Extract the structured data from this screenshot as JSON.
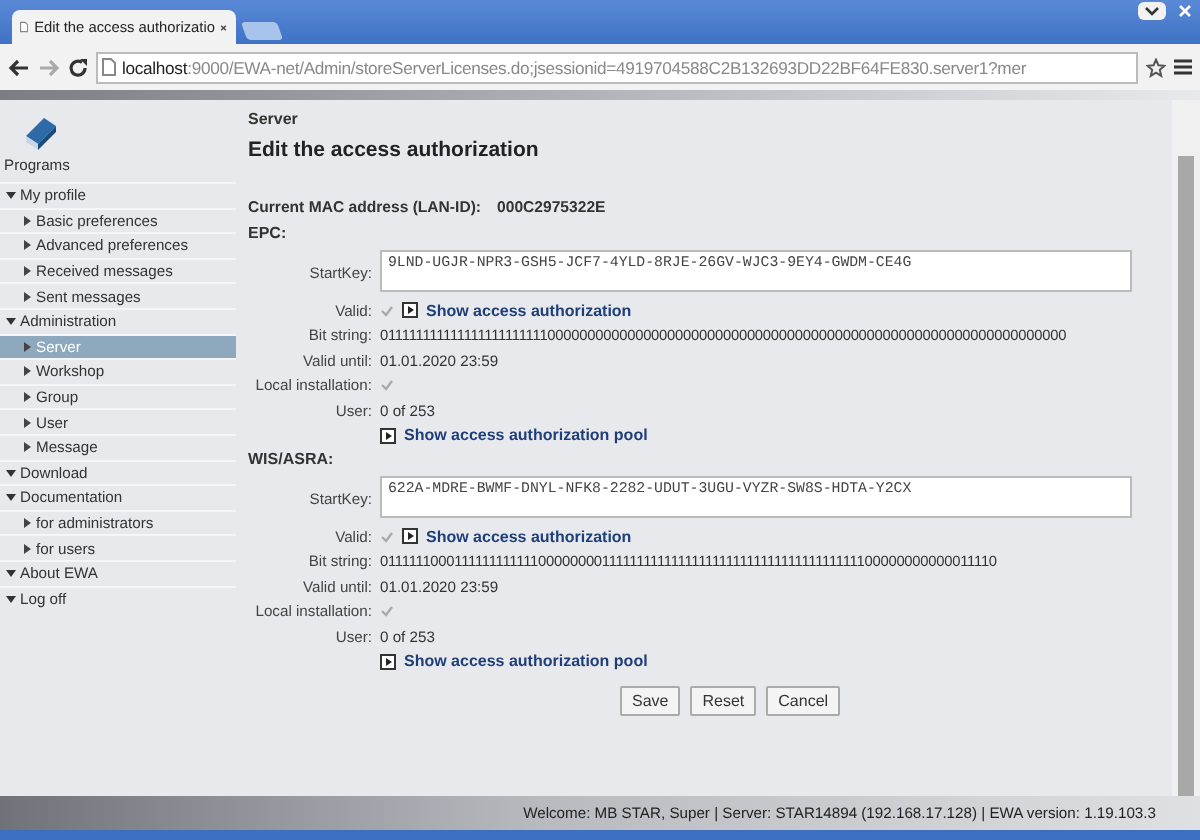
{
  "browser": {
    "tab_title": "Edit the access authorizatio",
    "url_host": "localhost",
    "url_rest": ":9000/EWA-net/Admin/storeServerLicenses.do;jsessionid=4919704588C2B132693DD22BF64FE830.server1?mer"
  },
  "sidebar": {
    "title": "Programs",
    "items": [
      {
        "label": "My profile",
        "expanded": true,
        "selected": false,
        "children": [
          {
            "label": "Basic preferences",
            "selected": false
          },
          {
            "label": "Advanced preferences",
            "selected": false
          },
          {
            "label": "Received messages",
            "selected": false
          },
          {
            "label": "Sent messages",
            "selected": false
          }
        ]
      },
      {
        "label": "Administration",
        "expanded": true,
        "selected": false,
        "children": [
          {
            "label": "Server",
            "selected": true
          },
          {
            "label": "Workshop",
            "selected": false
          },
          {
            "label": "Group",
            "selected": false
          },
          {
            "label": "User",
            "selected": false
          },
          {
            "label": "Message",
            "selected": false
          }
        ]
      },
      {
        "label": "Download",
        "expanded": true,
        "selected": false
      },
      {
        "label": "Documentation",
        "expanded": true,
        "selected": false,
        "children": [
          {
            "label": "for administrators",
            "selected": false
          },
          {
            "label": "for users",
            "selected": false
          }
        ]
      },
      {
        "label": "About EWA",
        "expanded": true,
        "selected": false
      },
      {
        "label": "Log off",
        "expanded": true,
        "selected": false
      }
    ]
  },
  "page": {
    "breadcrumb": "Server",
    "heading": "Edit the access authorization",
    "mac_label": "Current MAC address (LAN-ID):",
    "mac_value": "000C2975322E",
    "sections": [
      {
        "title": "EPC:",
        "fields": [
          {
            "kind": "textarea",
            "label": "StartKey:",
            "value": "9LND-UGJR-NPR3-GSH5-JCF7-4YLD-8RJE-26GV-WJC3-9EY4-GWDM-CE4G"
          },
          {
            "kind": "check-link",
            "label": "Valid:",
            "checked": true,
            "link": "Show access authorization"
          },
          {
            "kind": "text",
            "label": "Bit string:",
            "value": "01111111111111111111111100000000000000000000000000000000000000000000000000000000000000000"
          },
          {
            "kind": "text",
            "label": "Valid until:",
            "value": "01.01.2020 23:59"
          },
          {
            "kind": "check",
            "label": "Local installation:",
            "checked": true
          },
          {
            "kind": "text",
            "label": "User:",
            "value": "0 of 253"
          },
          {
            "kind": "link",
            "link": "Show access authorization pool"
          }
        ]
      },
      {
        "title": "WIS/ASRA:",
        "fields": [
          {
            "kind": "textarea",
            "label": "StartKey:",
            "value": "622A-MDRE-BWMF-DNYL-NFK8-2282-UDUT-3UGU-VYZR-SW8S-HDTA-Y2CX"
          },
          {
            "kind": "check-link",
            "label": "Valid:",
            "checked": true,
            "link": "Show access authorization"
          },
          {
            "kind": "text",
            "label": "Bit string:",
            "value": "0111111000111111111111000000001111111111111111111111111111111111111100000000000011110"
          },
          {
            "kind": "text",
            "label": "Valid until:",
            "value": "01.01.2020 23:59"
          },
          {
            "kind": "check",
            "label": "Local installation:",
            "checked": true
          },
          {
            "kind": "text",
            "label": "User:",
            "value": "0 of 253"
          },
          {
            "kind": "link",
            "link": "Show access authorization pool"
          }
        ]
      }
    ],
    "buttons": [
      "Save",
      "Reset",
      "Cancel"
    ]
  },
  "footer": {
    "status": "Welcome: MB STAR, Super | Server: STAR14894 (192.168.17.128) | EWA version: 1.19.103.3"
  }
}
